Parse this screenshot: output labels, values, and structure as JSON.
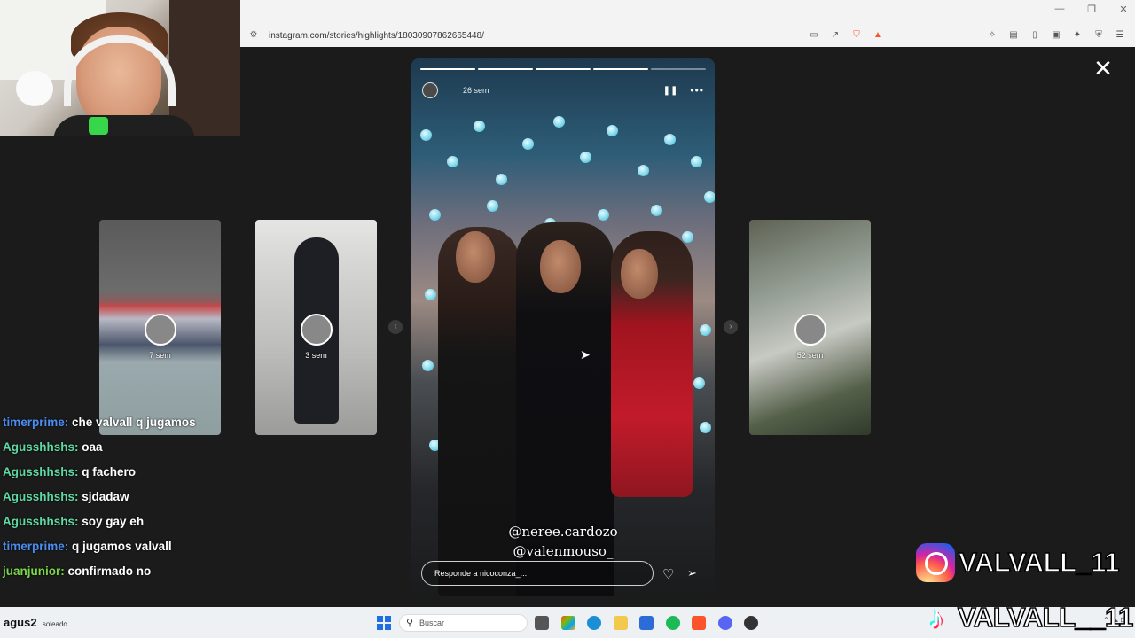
{
  "webcam": {},
  "browser": {
    "url": "instagram.com/stories/highlights/18030907862665448/",
    "window_controls": [
      "—",
      "❐",
      "✕"
    ]
  },
  "stories": {
    "prev2": {
      "time": "7 sem"
    },
    "prev1": {
      "time": "3 sem"
    },
    "current": {
      "time": "26 sem",
      "mentions": [
        "@neree.cardozo",
        "@valenmouso_"
      ],
      "reply_placeholder": "Responde a nicoconza_..."
    },
    "next": {
      "time": "52 sem"
    }
  },
  "chat": [
    {
      "user": "timerprime:",
      "text": "che valvall q jugamos",
      "color": "#4b8ef2"
    },
    {
      "user": "Agusshhshs:",
      "text": "oaa",
      "color": "#5fd9a3"
    },
    {
      "user": "Agusshhshs:",
      "text": "q fachero",
      "color": "#5fd9a3"
    },
    {
      "user": "Agusshhshs:",
      "text": "sjdadaw",
      "color": "#5fd9a3"
    },
    {
      "user": "Agusshhshs:",
      "text": "soy gay eh",
      "color": "#5fd9a3"
    },
    {
      "user": "timerprime:",
      "text": "q jugamos valvall",
      "color": "#4b8ef2"
    },
    {
      "user": "juanjunior:",
      "text": "confirmado no",
      "color": "#7cd84a"
    }
  ],
  "tags": {
    "instagram": "VALVALL_11",
    "tiktok": "VALVALL__11"
  },
  "taskbar": {
    "weather_temp": "agus2",
    "weather_desc": "soleado",
    "search_label": "Buscar"
  },
  "colors": {
    "brand_instagram": "#d6249f",
    "story_red_dress": "#c21b2a"
  }
}
